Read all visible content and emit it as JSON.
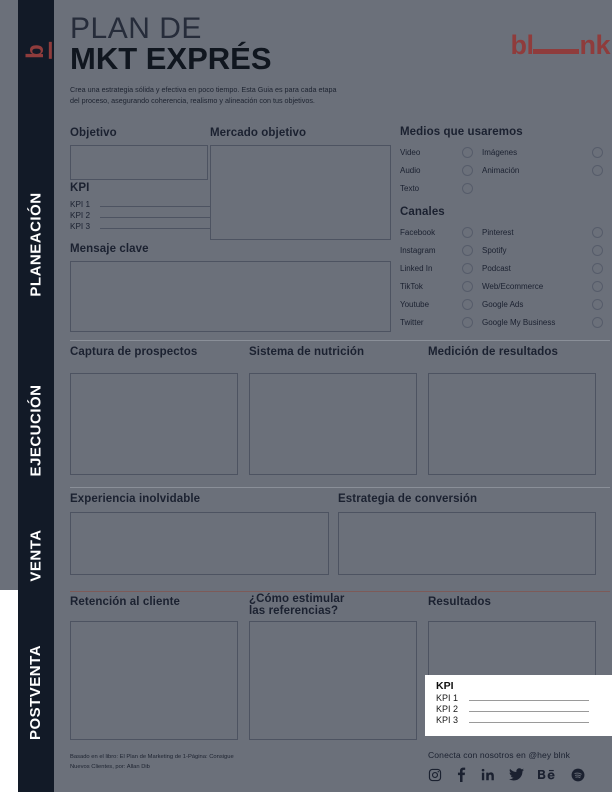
{
  "brand": {
    "rail_logo": "b",
    "logo_prefix": "bl",
    "logo_suffix": "nk",
    "accent_color": "#8f3c3c",
    "dark_color": "#121a27",
    "page_bg": "#6b707a"
  },
  "header": {
    "title_line1": "PLAN DE",
    "title_line2": "MKT  EXPRÉS",
    "subtitle": "Crea una estrategia sólida y efectiva en poco tiempo. Esta Guia es para cada etapa del proceso, asegurando coherencia, realismo y alineación con tus objetivos."
  },
  "stages": [
    {
      "label": "PLANEACIÓN"
    },
    {
      "label": "EJECUCIÓN"
    },
    {
      "label": "VENTA"
    },
    {
      "label": "POSTVENTA"
    }
  ],
  "planeacion": {
    "objetivo_title": "Objetivo",
    "mercado_title": "Mercado objetivo",
    "kpi_title": "KPI",
    "kpi_rows": [
      "KPI 1",
      "KPI 2",
      "KPI 3"
    ],
    "mensaje_title": "Mensaje clave",
    "medios_title": "Medios que usaremos",
    "medios_left": [
      "Video",
      "Audio",
      "Texto"
    ],
    "medios_right": [
      "Imágenes",
      "Animación"
    ],
    "canales_title": "Canales",
    "canales_left": [
      "Facebook",
      "Instagram",
      "Linked In",
      "TikTok",
      "Youtube",
      "Twitter"
    ],
    "canales_right": [
      "Pinterest",
      "Spotify",
      "Podcast",
      "Web/Ecommerce",
      "Google Ads",
      "Google My Business"
    ]
  },
  "ejecucion": {
    "captura_title": "Captura de prospectos",
    "nutricion_title": "Sistema de nutrición",
    "medicion_title": "Medición de resultados"
  },
  "venta": {
    "experiencia_title": "Experiencia inolvidable",
    "conversion_title": "Estrategia de conversión"
  },
  "postventa": {
    "retencion_title": "Retención al cliente",
    "referencias_title_line1": "¿Cómo estimular",
    "referencias_title_line2": "las referencias?",
    "resultados_title": "Resultados",
    "kpi_title": "KPI",
    "kpi_rows": [
      "KPI 1",
      "KPI 2",
      "KPI 3"
    ]
  },
  "footer": {
    "credit_line1": "Basado en el libro:  El Plan de Marketing de 1-Página: Consigue",
    "credit_line2": "Nuevos Clientes, por: Allan Dib",
    "cta": "Conecta con nosotros en @hey blnk",
    "socials": [
      "instagram-icon",
      "facebook-icon",
      "linkedin-icon",
      "twitter-icon",
      "behance-icon",
      "spotify-icon"
    ]
  }
}
